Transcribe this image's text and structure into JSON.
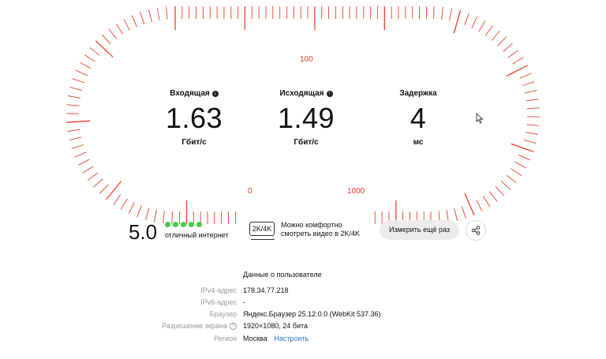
{
  "gauge": {
    "tick_label_top": "100",
    "tick_label_zero": "0",
    "tick_label_max": "1000",
    "color": "#e8412a"
  },
  "metrics": {
    "download": {
      "label": "Входящая",
      "icon": "arrow-down-icon",
      "value": "1.63",
      "unit": "Гбит/с"
    },
    "upload": {
      "label": "Исходящая",
      "icon": "arrow-up-icon",
      "value": "1.49",
      "unit": "Гбит/с"
    },
    "latency": {
      "label": "Задержка",
      "value": "4",
      "unit": "мс"
    }
  },
  "score": {
    "value": "5.0",
    "stars": 5,
    "text": "отличный интернет",
    "dot_color": "#3fd245"
  },
  "video": {
    "badge": "2K/4K",
    "line1": "Можно комфортно",
    "line2": "смотреть видео в 2K/4K"
  },
  "actions": {
    "retest": "Измерить ещё раз",
    "share_icon": "share-icon"
  },
  "user_info": {
    "title": "Данные о пользователе",
    "rows": [
      {
        "key": "IPv4-адрес",
        "value": "178.34.77.218"
      },
      {
        "key": "IPv6-адрес",
        "value": "-"
      },
      {
        "key": "Браузер",
        "value": "Яндекс.Браузер 25.12.0.0 (WebKit 537.36)"
      },
      {
        "key": "Разрешение экрана",
        "value": "1920×1080, 24 бита"
      },
      {
        "key": "Регион",
        "value": "Москва",
        "link": "Настроить"
      }
    ]
  }
}
